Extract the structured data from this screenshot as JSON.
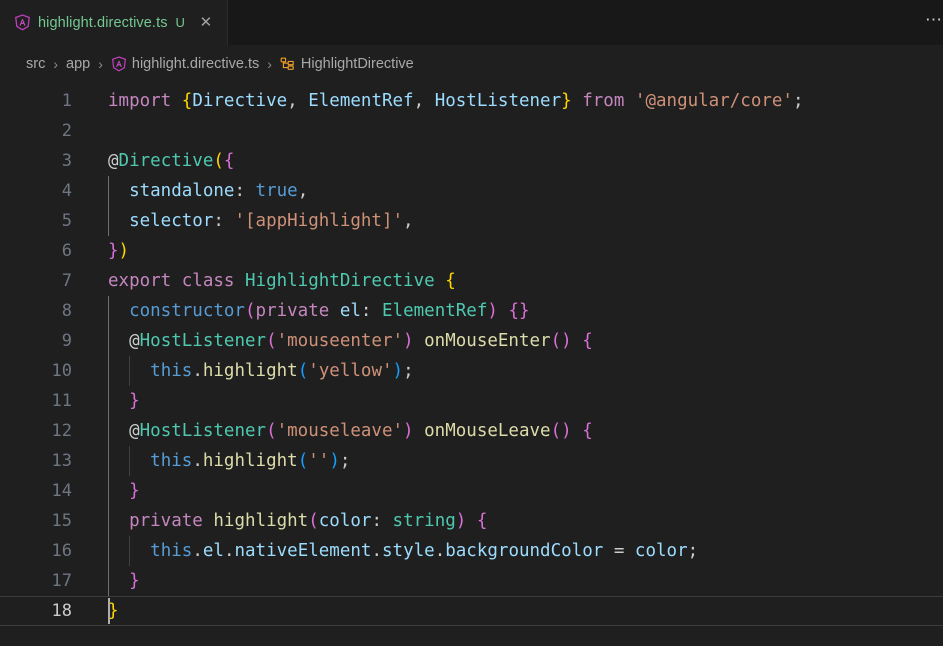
{
  "window": {
    "background": "#1f1f1f",
    "tabbar_background": "#181818"
  },
  "tab": {
    "icon": "angular-file-icon",
    "filename": "highlight.directive.ts",
    "git_badge": "U",
    "close_glyph": "✕",
    "label_color": "#73c991"
  },
  "tabbar": {
    "more_actions_glyph": "⋯"
  },
  "breadcrumbs": {
    "separator": "›",
    "items": [
      {
        "label": "src",
        "icon": null
      },
      {
        "label": "app",
        "icon": null
      },
      {
        "label": "highlight.directive.ts",
        "icon": "angular-file-icon"
      },
      {
        "label": "HighlightDirective",
        "icon": "class-symbol-icon"
      }
    ]
  },
  "editor": {
    "active_line": 18,
    "line_numbers": [
      "1",
      "2",
      "3",
      "4",
      "5",
      "6",
      "7",
      "8",
      "9",
      "10",
      "11",
      "12",
      "13",
      "14",
      "15",
      "16",
      "17",
      "18"
    ],
    "language": "typescript",
    "colors": {
      "keyword": "#C586C0",
      "variable": "#9CDCFE",
      "type": "#4EC9B0",
      "function": "#DCDCAA",
      "string": "#CE9178",
      "constant": "#569CD6",
      "plain": "#CCCCCC",
      "bracket_yellow": "#FFD700",
      "bracket_pink": "#DA70D6",
      "bracket_blue": "#179FFF",
      "line_number": "#6e7681",
      "line_number_active": "#cccccc"
    },
    "lines": [
      {
        "n": 1,
        "indents": [],
        "tokens": [
          {
            "t": "import",
            "c": "t-kw"
          },
          {
            "t": " ",
            "c": "t-plain"
          },
          {
            "t": "{",
            "c": "t-b-yellow"
          },
          {
            "t": "Directive",
            "c": "t-var"
          },
          {
            "t": ",",
            "c": "t-plain"
          },
          {
            "t": " ",
            "c": "t-plain"
          },
          {
            "t": "ElementRef",
            "c": "t-var"
          },
          {
            "t": ",",
            "c": "t-plain"
          },
          {
            "t": " ",
            "c": "t-plain"
          },
          {
            "t": "HostListener",
            "c": "t-var"
          },
          {
            "t": "}",
            "c": "t-b-yellow"
          },
          {
            "t": " ",
            "c": "t-plain"
          },
          {
            "t": "from",
            "c": "t-kw"
          },
          {
            "t": " ",
            "c": "t-plain"
          },
          {
            "t": "'@angular/core'",
            "c": "t-str"
          },
          {
            "t": ";",
            "c": "t-plain"
          }
        ]
      },
      {
        "n": 2,
        "indents": [],
        "tokens": []
      },
      {
        "n": 3,
        "indents": [],
        "tokens": [
          {
            "t": "@",
            "c": "t-plain"
          },
          {
            "t": "Directive",
            "c": "t-type"
          },
          {
            "t": "(",
            "c": "t-b-yellow"
          },
          {
            "t": "{",
            "c": "t-b-pink"
          }
        ]
      },
      {
        "n": 4,
        "indents": [
          0
        ],
        "tokens": [
          {
            "t": "  ",
            "c": "t-plain"
          },
          {
            "t": "standalone",
            "c": "t-var"
          },
          {
            "t": ":",
            "c": "t-plain"
          },
          {
            "t": " ",
            "c": "t-plain"
          },
          {
            "t": "true",
            "c": "t-const"
          },
          {
            "t": ",",
            "c": "t-plain"
          }
        ]
      },
      {
        "n": 5,
        "indents": [
          0
        ],
        "tokens": [
          {
            "t": "  ",
            "c": "t-plain"
          },
          {
            "t": "selector",
            "c": "t-var"
          },
          {
            "t": ":",
            "c": "t-plain"
          },
          {
            "t": " ",
            "c": "t-plain"
          },
          {
            "t": "'[appHighlight]'",
            "c": "t-str"
          },
          {
            "t": ",",
            "c": "t-plain"
          }
        ]
      },
      {
        "n": 6,
        "indents": [],
        "tokens": [
          {
            "t": "}",
            "c": "t-b-pink"
          },
          {
            "t": ")",
            "c": "t-b-yellow"
          }
        ]
      },
      {
        "n": 7,
        "indents": [],
        "tokens": [
          {
            "t": "export",
            "c": "t-kw"
          },
          {
            "t": " ",
            "c": "t-plain"
          },
          {
            "t": "class",
            "c": "t-kw"
          },
          {
            "t": " ",
            "c": "t-plain"
          },
          {
            "t": "HighlightDirective",
            "c": "t-type"
          },
          {
            "t": " ",
            "c": "t-plain"
          },
          {
            "t": "{",
            "c": "t-b-yellow"
          }
        ]
      },
      {
        "n": 8,
        "indents": [
          0
        ],
        "tokens": [
          {
            "t": "  ",
            "c": "t-plain"
          },
          {
            "t": "constructor",
            "c": "t-const"
          },
          {
            "t": "(",
            "c": "t-b-pink"
          },
          {
            "t": "private",
            "c": "t-kw"
          },
          {
            "t": " ",
            "c": "t-plain"
          },
          {
            "t": "el",
            "c": "t-var"
          },
          {
            "t": ":",
            "c": "t-plain"
          },
          {
            "t": " ",
            "c": "t-plain"
          },
          {
            "t": "ElementRef",
            "c": "t-type"
          },
          {
            "t": ")",
            "c": "t-b-pink"
          },
          {
            "t": " ",
            "c": "t-plain"
          },
          {
            "t": "{",
            "c": "t-b-pink"
          },
          {
            "t": "}",
            "c": "t-b-pink"
          }
        ]
      },
      {
        "n": 9,
        "indents": [
          0
        ],
        "tokens": [
          {
            "t": "  ",
            "c": "t-plain"
          },
          {
            "t": "@",
            "c": "t-plain"
          },
          {
            "t": "HostListener",
            "c": "t-type"
          },
          {
            "t": "(",
            "c": "t-b-pink"
          },
          {
            "t": "'mouseenter'",
            "c": "t-str"
          },
          {
            "t": ")",
            "c": "t-b-pink"
          },
          {
            "t": " ",
            "c": "t-plain"
          },
          {
            "t": "onMouseEnter",
            "c": "t-fn"
          },
          {
            "t": "(",
            "c": "t-b-pink"
          },
          {
            "t": ")",
            "c": "t-b-pink"
          },
          {
            "t": " ",
            "c": "t-plain"
          },
          {
            "t": "{",
            "c": "t-b-pink"
          }
        ]
      },
      {
        "n": 10,
        "indents": [
          0,
          1
        ],
        "tokens": [
          {
            "t": "    ",
            "c": "t-plain"
          },
          {
            "t": "this",
            "c": "t-const"
          },
          {
            "t": ".",
            "c": "t-plain"
          },
          {
            "t": "highlight",
            "c": "t-fn"
          },
          {
            "t": "(",
            "c": "t-b-blue"
          },
          {
            "t": "'yellow'",
            "c": "t-str"
          },
          {
            "t": ")",
            "c": "t-b-blue"
          },
          {
            "t": ";",
            "c": "t-plain"
          }
        ]
      },
      {
        "n": 11,
        "indents": [
          0
        ],
        "tokens": [
          {
            "t": "  ",
            "c": "t-plain"
          },
          {
            "t": "}",
            "c": "t-b-pink"
          }
        ]
      },
      {
        "n": 12,
        "indents": [
          0
        ],
        "tokens": [
          {
            "t": "  ",
            "c": "t-plain"
          },
          {
            "t": "@",
            "c": "t-plain"
          },
          {
            "t": "HostListener",
            "c": "t-type"
          },
          {
            "t": "(",
            "c": "t-b-pink"
          },
          {
            "t": "'mouseleave'",
            "c": "t-str"
          },
          {
            "t": ")",
            "c": "t-b-pink"
          },
          {
            "t": " ",
            "c": "t-plain"
          },
          {
            "t": "onMouseLeave",
            "c": "t-fn"
          },
          {
            "t": "(",
            "c": "t-b-pink"
          },
          {
            "t": ")",
            "c": "t-b-pink"
          },
          {
            "t": " ",
            "c": "t-plain"
          },
          {
            "t": "{",
            "c": "t-b-pink"
          }
        ]
      },
      {
        "n": 13,
        "indents": [
          0,
          1
        ],
        "tokens": [
          {
            "t": "    ",
            "c": "t-plain"
          },
          {
            "t": "this",
            "c": "t-const"
          },
          {
            "t": ".",
            "c": "t-plain"
          },
          {
            "t": "highlight",
            "c": "t-fn"
          },
          {
            "t": "(",
            "c": "t-b-blue"
          },
          {
            "t": "''",
            "c": "t-str"
          },
          {
            "t": ")",
            "c": "t-b-blue"
          },
          {
            "t": ";",
            "c": "t-plain"
          }
        ]
      },
      {
        "n": 14,
        "indents": [
          0
        ],
        "tokens": [
          {
            "t": "  ",
            "c": "t-plain"
          },
          {
            "t": "}",
            "c": "t-b-pink"
          }
        ]
      },
      {
        "n": 15,
        "indents": [
          0
        ],
        "tokens": [
          {
            "t": "  ",
            "c": "t-plain"
          },
          {
            "t": "private",
            "c": "t-kw"
          },
          {
            "t": " ",
            "c": "t-plain"
          },
          {
            "t": "highlight",
            "c": "t-fn"
          },
          {
            "t": "(",
            "c": "t-b-pink"
          },
          {
            "t": "color",
            "c": "t-var"
          },
          {
            "t": ":",
            "c": "t-plain"
          },
          {
            "t": " ",
            "c": "t-plain"
          },
          {
            "t": "string",
            "c": "t-type"
          },
          {
            "t": ")",
            "c": "t-b-pink"
          },
          {
            "t": " ",
            "c": "t-plain"
          },
          {
            "t": "{",
            "c": "t-b-pink"
          }
        ]
      },
      {
        "n": 16,
        "indents": [
          0,
          1
        ],
        "tokens": [
          {
            "t": "    ",
            "c": "t-plain"
          },
          {
            "t": "this",
            "c": "t-const"
          },
          {
            "t": ".",
            "c": "t-plain"
          },
          {
            "t": "el",
            "c": "t-var"
          },
          {
            "t": ".",
            "c": "t-plain"
          },
          {
            "t": "nativeElement",
            "c": "t-var"
          },
          {
            "t": ".",
            "c": "t-plain"
          },
          {
            "t": "style",
            "c": "t-var"
          },
          {
            "t": ".",
            "c": "t-plain"
          },
          {
            "t": "backgroundColor",
            "c": "t-var"
          },
          {
            "t": " ",
            "c": "t-plain"
          },
          {
            "t": "=",
            "c": "t-plain"
          },
          {
            "t": " ",
            "c": "t-plain"
          },
          {
            "t": "color",
            "c": "t-var"
          },
          {
            "t": ";",
            "c": "t-plain"
          }
        ]
      },
      {
        "n": 17,
        "indents": [
          0
        ],
        "tokens": [
          {
            "t": "  ",
            "c": "t-plain"
          },
          {
            "t": "}",
            "c": "t-b-pink"
          }
        ]
      },
      {
        "n": 18,
        "indents": [],
        "tokens": [
          {
            "t": "}",
            "c": "t-b-yellow"
          }
        ]
      }
    ]
  }
}
